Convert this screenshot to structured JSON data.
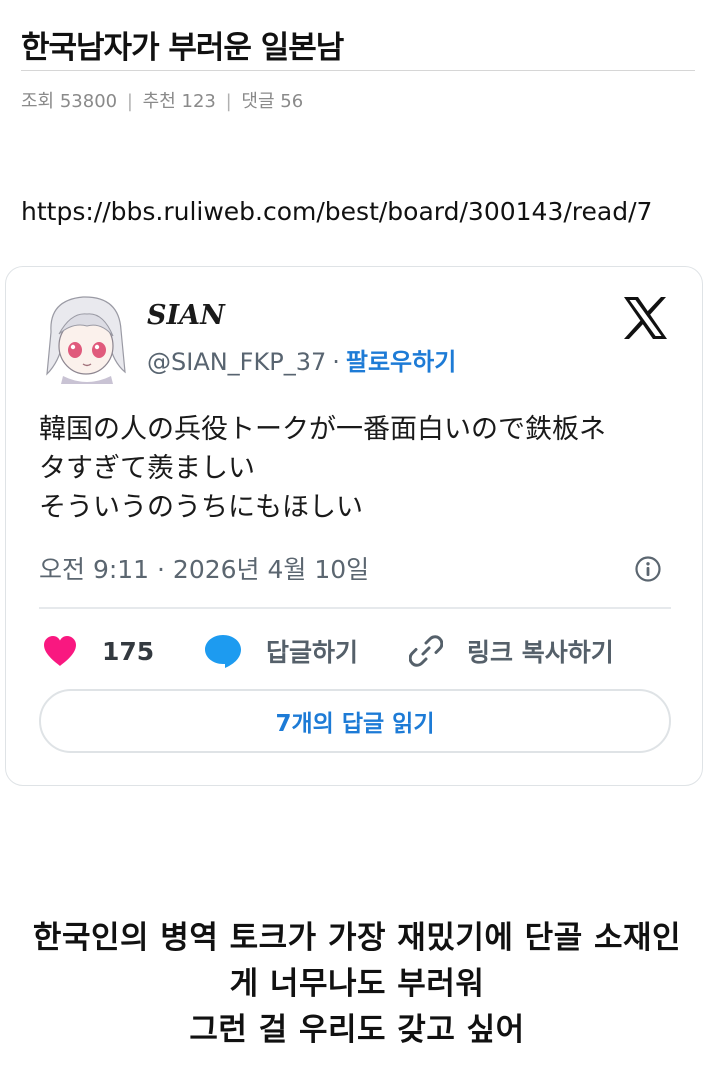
{
  "post": {
    "title": "한국남자가 부러운 일본남",
    "meta": {
      "views": "조회 53800",
      "recommends": "추천 123",
      "comments": "댓글 56",
      "separator": "|"
    },
    "source_url": "https://bbs.ruliweb.com/best/board/300143/read/7"
  },
  "tweet": {
    "author_name": "SIAN",
    "handle": "@SIAN_FKP_37",
    "handle_separator": "·",
    "follow_label": "팔로우하기",
    "platform_icon": "x-logo-icon",
    "avatar_icon": "anime-girl-avatar",
    "text_lines": [
      "韓国の人の兵役トークが一番面白いので鉄板ネ",
      "タすぎて羨ましい",
      "そういうのうちにもほしい"
    ],
    "timestamp": "오전 9:11 · 2026년 4월 10일",
    "likes": "175",
    "reply_label": "답글하기",
    "copy_link_label": "링크 복사하기",
    "read_replies_label": "7개의 답글 읽기",
    "colors": {
      "like": "#f91880",
      "reply": "#1d9bf0",
      "link": "#1d7bd6"
    }
  },
  "caption": {
    "lines": [
      "한국인의 병역 토크가 가장 재밌기에 단골 소재인",
      "게 너무나도 부러워",
      "그런 걸 우리도 갖고 싶어"
    ]
  }
}
